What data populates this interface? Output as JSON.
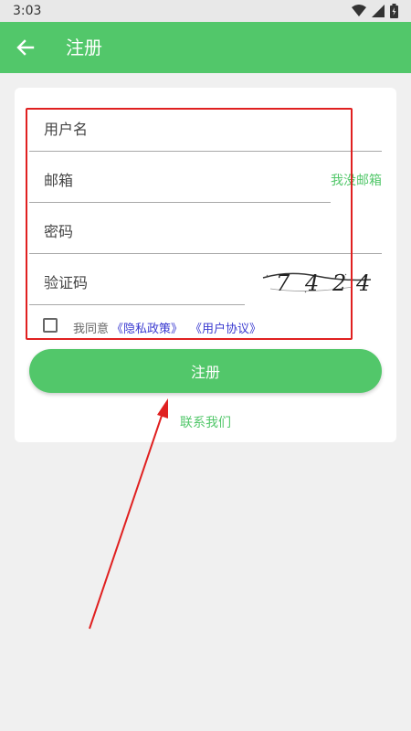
{
  "status_bar": {
    "time": "3:03"
  },
  "app_bar": {
    "title": "注册"
  },
  "form": {
    "username_placeholder": "用户名",
    "email_placeholder": "邮箱",
    "no_email_link": "我没邮箱",
    "password_placeholder": "密码",
    "captcha_placeholder": "验证码",
    "captcha_chars": [
      "7",
      "4",
      "2",
      "4"
    ],
    "agree_prefix": "我同意",
    "privacy_policy_link": "《隐私政策》",
    "user_agreement_link": "《用户协议》",
    "register_button": "注册",
    "contact_link": "联系我们"
  },
  "colors": {
    "primary": "#52c76a",
    "annotation": "#e02020",
    "link_blue": "#3a3ad0"
  }
}
